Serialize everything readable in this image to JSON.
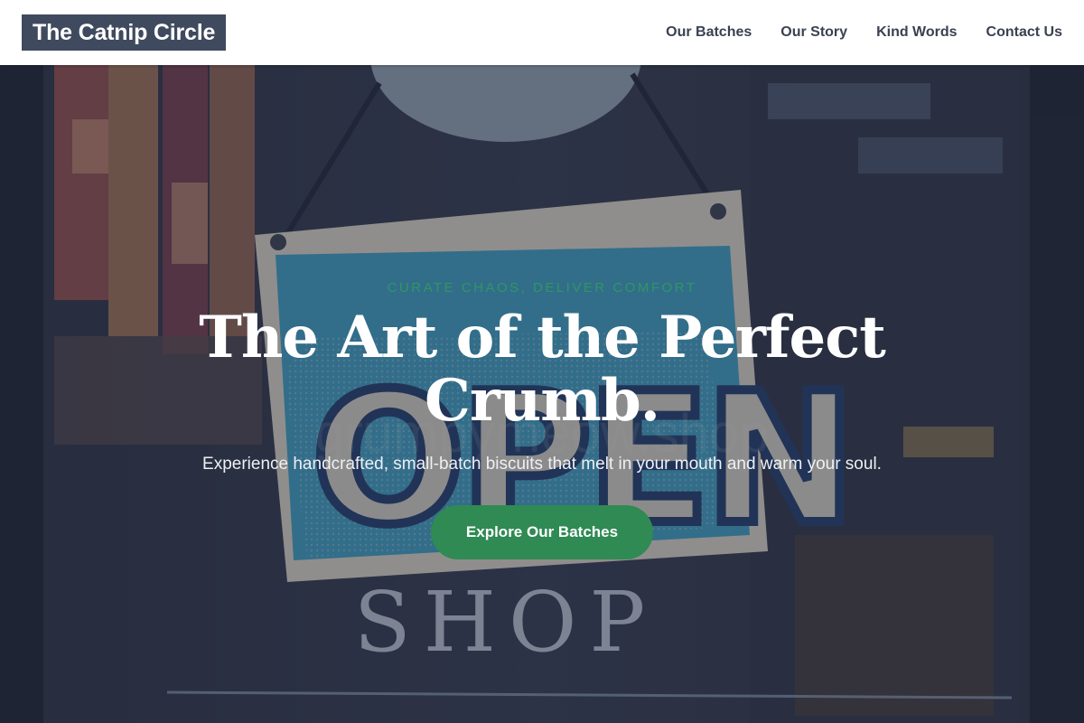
{
  "header": {
    "brand": "The Catnip Circle",
    "nav": [
      {
        "label": "Our Batches"
      },
      {
        "label": "Our Story"
      },
      {
        "label": "Kind Words"
      },
      {
        "label": "Contact Us"
      }
    ]
  },
  "hero": {
    "eyebrow": "Curate Chaos, Deliver Comfort",
    "headline": "The Art of the Perfect Crumb.",
    "subhead": "Experience handcrafted, small-batch biscuits that melt in your mouth and warm your soul.",
    "cta_label": "Explore Our Batches",
    "background": {
      "sign_text": "OPEN",
      "window_text": "grumpymeow.shop",
      "door_text": "SHOP"
    }
  },
  "colors": {
    "brand_bg": "#3f4a5e",
    "accent_green": "#2f8a53",
    "eyebrow_green": "#2f9e5a",
    "nav_text": "#3a4150"
  }
}
